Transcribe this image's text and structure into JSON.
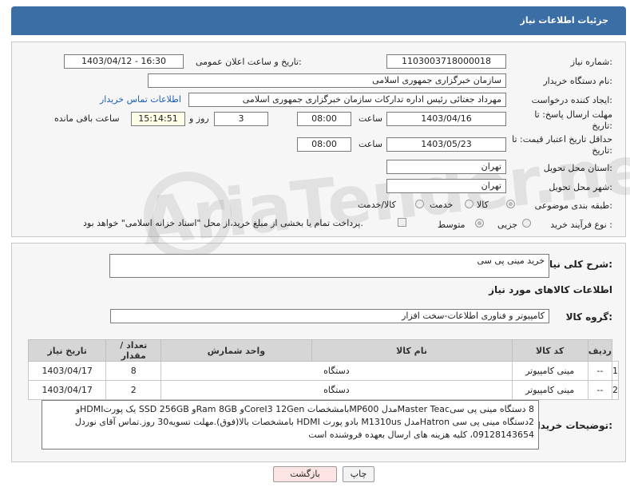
{
  "header": {
    "title": "جزئیات اطلاعات نیاز"
  },
  "form": {
    "need_number_label": "شماره نیاز:",
    "need_number": "1103003718000018",
    "announce_label": "تاریخ و ساعت اعلان عمومی:",
    "announce_value": "1403/04/12 - 16:30",
    "buyer_org_label": "نام دستگاه خریدار:",
    "buyer_org": "سازمان خبرگزاری جمهوری اسلامی",
    "creator_label": "ایجاد کننده درخواست:",
    "creator": "مهرداد جغتائی رئیس اداره تدارکات سازمان خبرگزاری جمهوری اسلامی",
    "contact_link": "اطلاعات تماس خریدار",
    "reply_deadline_label": "مهلت ارسال پاسخ: تا تاریخ:",
    "reply_date": "1403/04/16",
    "time_label": "ساعت",
    "reply_time": "08:00",
    "days_value": "3",
    "days_label": "روز و",
    "remaining_time": "15:14:51",
    "remaining_label": "ساعت باقی مانده",
    "price_validity_label": "حداقل تاریخ اعتبار قیمت: تا تاریخ:",
    "price_date": "1403/05/23",
    "price_time_label": "ساعت",
    "price_time": "08:00",
    "province_label": "استان محل تحویل:",
    "province": "تهران",
    "city_label": "شهر محل تحویل:",
    "city": "تهران",
    "category_label": "طبقه بندی موضوعی:",
    "category_options": [
      "کالا",
      "خدمت",
      "کالا/خدمت"
    ],
    "process_label": "نوع فرآیند خرید :",
    "process_options": [
      "جزیی",
      "متوسط"
    ],
    "payment_note": "پرداخت تمام یا بخشی از مبلغ خرید،از محل \"اسناد خزانه اسلامی\" خواهد بود."
  },
  "details": {
    "summary_label": "شرح کلی نیاز:",
    "summary": "خرید مینی پی سی",
    "goods_info_title": "اطلاعات کالاهای مورد نیاز",
    "goods_group_label": "گروه کالا:",
    "goods_group": "کامپیوتر و فناوری اطلاعات-سخت افزار"
  },
  "table": {
    "headers": [
      "ردیف",
      "کد کالا",
      "نام کالا",
      "واحد شمارش",
      "تعداد / مقدار",
      "تاریخ نیاز"
    ],
    "rows": [
      [
        "1",
        "--",
        "مینی کامپیوتر",
        "دستگاه",
        "8",
        "1403/04/17"
      ],
      [
        "2",
        "--",
        "مینی کامپیوتر",
        "دستگاه",
        "2",
        "1403/04/17"
      ]
    ]
  },
  "buyer_notes": {
    "label": "توضیحات خریدار:",
    "lines": [
      "8 دستگاه مینی پی سیMaster Teacمدل MP600بامشخصات CoreI3 12Genو Ram 8GBو SSD 256GB یک پورتHDMIو",
      "2دستگاه مینی پی سی Hatronمدل M1310us بادو پورت HDMI بامشخصات بالا(فوق).مهلت تسویه30 روز.تماس آقای نوردل",
      "09128143654، کلیه هزینه های ارسال بعهده فروشنده است"
    ]
  },
  "buttons": {
    "print": "چاپ",
    "back": "بازگشت"
  },
  "watermark": "AriaTender.net"
}
